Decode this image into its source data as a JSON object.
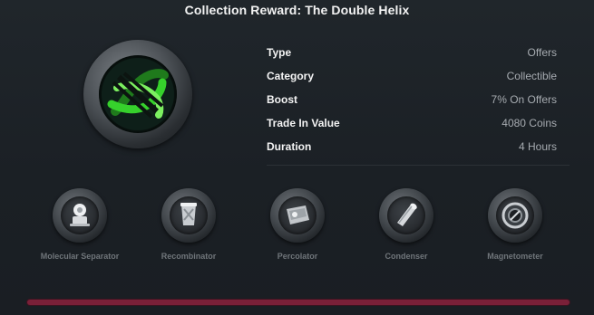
{
  "title": "Collection Reward: The Double Helix",
  "reward": {
    "icon": "double-helix-icon",
    "accent_color": "#35c22e",
    "details": [
      {
        "key": "Type",
        "value": "Offers"
      },
      {
        "key": "Category",
        "value": "Collectible"
      },
      {
        "key": "Boost",
        "value": "7% On Offers"
      },
      {
        "key": "Trade In Value",
        "value": "4080 Coins"
      },
      {
        "key": "Duration",
        "value": "4 Hours"
      }
    ]
  },
  "machines": [
    {
      "label": "Molecular Separator",
      "icon": "molecular-separator-icon"
    },
    {
      "label": "Recombinator",
      "icon": "recombinator-icon"
    },
    {
      "label": "Percolator",
      "icon": "percolator-icon"
    },
    {
      "label": "Condenser",
      "icon": "condenser-icon"
    },
    {
      "label": "Magnetometer",
      "icon": "magnetometer-icon"
    }
  ],
  "progress": {
    "value": 1.0,
    "color": "#7a2038"
  }
}
